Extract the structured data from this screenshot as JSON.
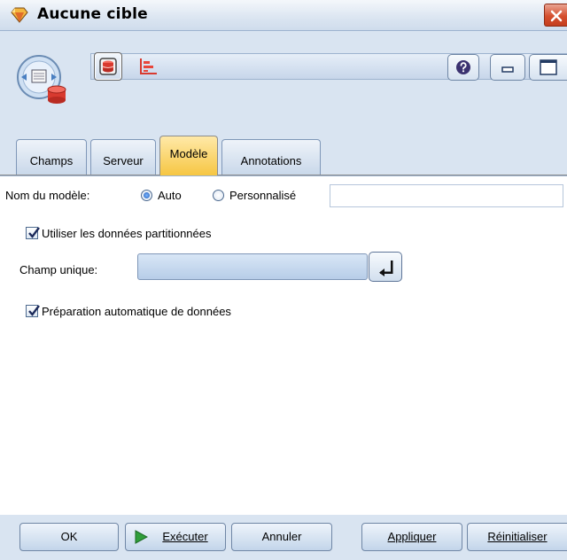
{
  "window": {
    "title": "Aucune cible"
  },
  "tabs": [
    {
      "label": "Champs"
    },
    {
      "label": "Serveur"
    },
    {
      "label": "Modèle"
    },
    {
      "label": "Annotations"
    }
  ],
  "active_tab": "Modèle",
  "model": {
    "name_label": "Nom du modèle:",
    "auto_label": "Auto",
    "custom_label": "Personnalisé",
    "name_value": "",
    "use_partitioned_label": "Utiliser les données partitionnées",
    "use_partitioned_checked": true,
    "unique_field_label": "Champ unique:",
    "unique_field_value": "",
    "auto_prep_label": "Préparation automatique de données",
    "auto_prep_checked": true,
    "name_mode": "Auto"
  },
  "footer": {
    "ok": "OK",
    "execute": "Exécuter",
    "cancel": "Annuler",
    "apply": "Appliquer",
    "reset": "Réinitialiser"
  },
  "colors": {
    "active_tab": "#f6c642",
    "title_close": "#d5502f",
    "panel_bg": "#d9e4f1"
  },
  "icons": [
    "diamond-app-icon",
    "close-icon",
    "node-model-icon",
    "database-icon",
    "chart-icon",
    "help-icon",
    "minimize-icon",
    "maximize-icon",
    "field-picker-icon",
    "play-icon"
  ]
}
